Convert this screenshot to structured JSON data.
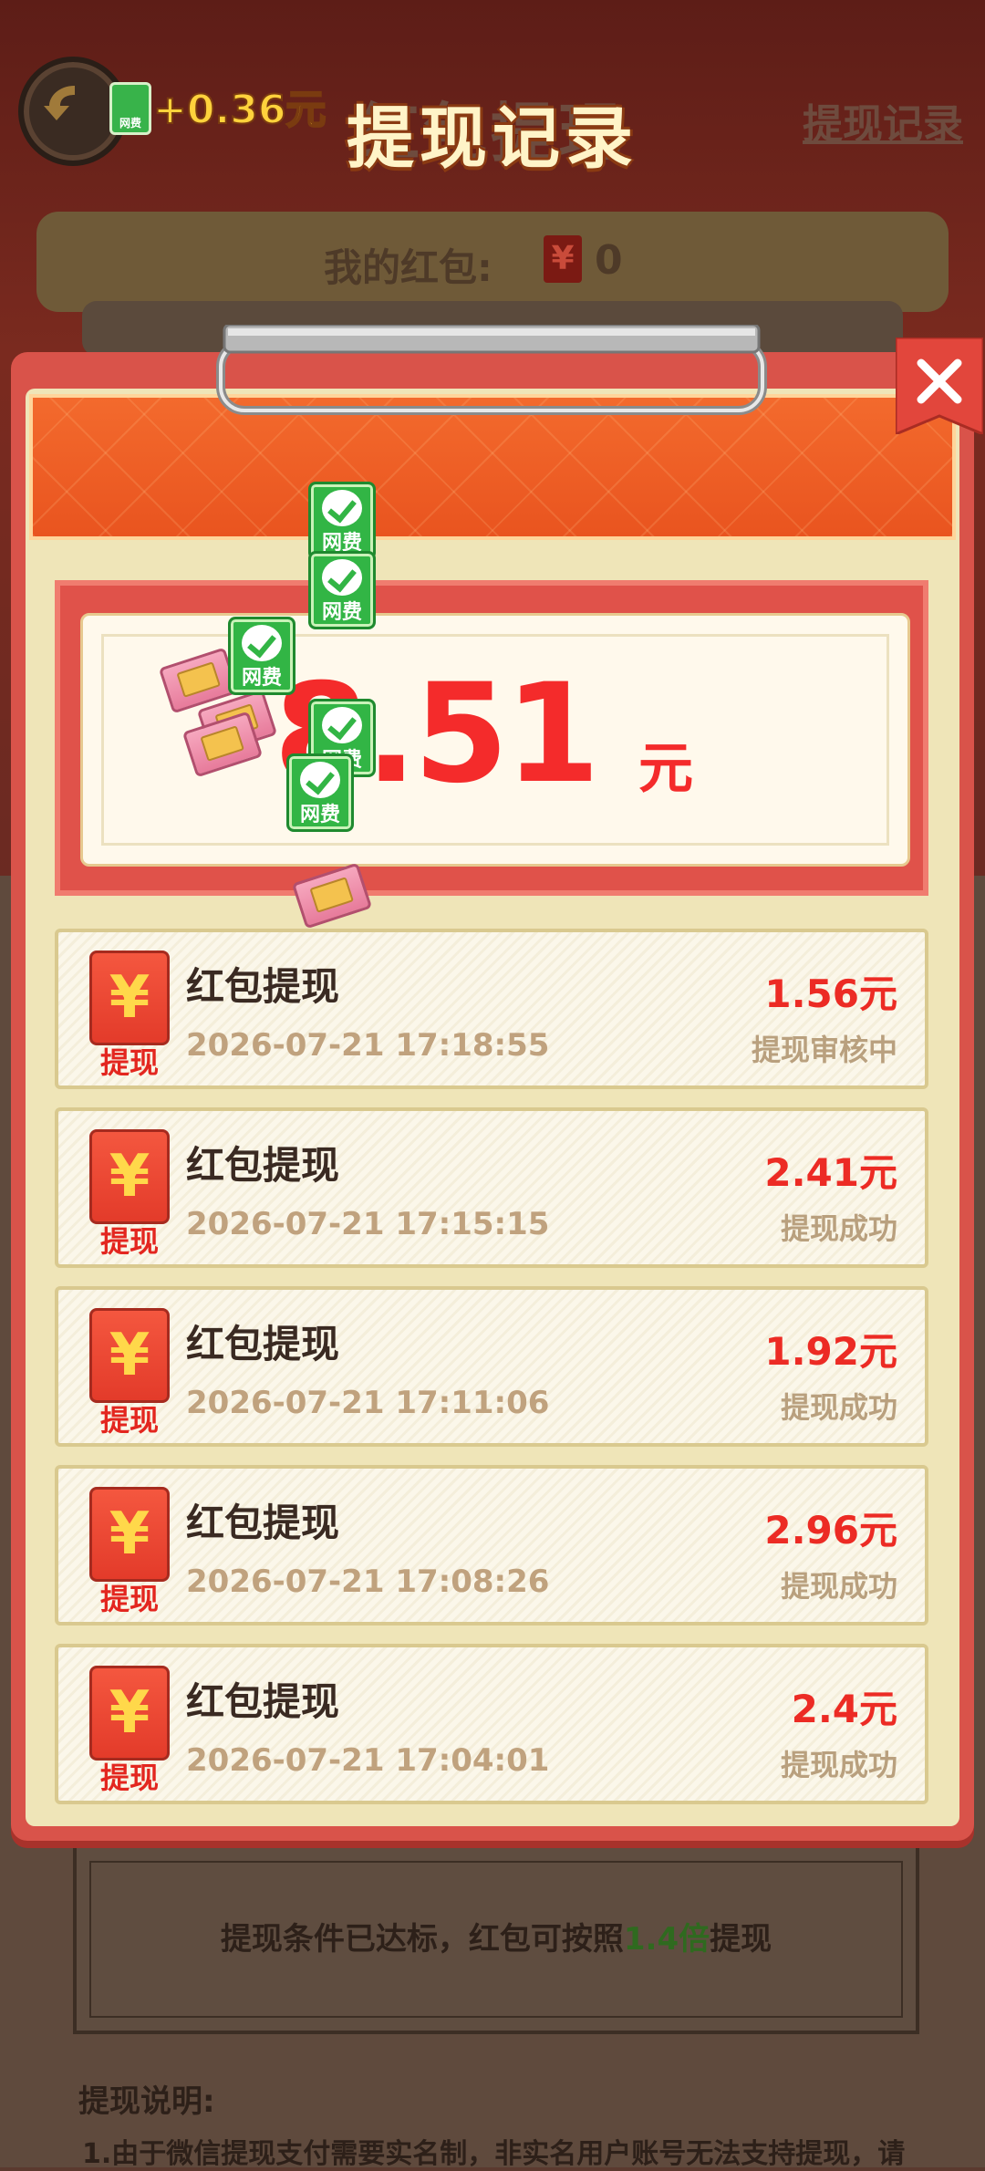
{
  "header": {
    "earn_text": "+0.36元",
    "earn_badge_label": "网费",
    "title": "红包提现",
    "record_link": "提现记录"
  },
  "balance": {
    "label": "我的红包:",
    "yen": "¥",
    "value": "0"
  },
  "condition": {
    "prefix": "提现条件已达标，红包可按照",
    "highlight": "1.4倍",
    "suffix": "提现"
  },
  "explain": {
    "title": "提现说明:",
    "line1": "1.由于微信提现支付需要实名制，非实名用户账号无法支持提现，请"
  },
  "modal": {
    "title": "提现记录",
    "total_value": "8.51",
    "total_unit": "元",
    "fly_badge_label": "网费",
    "records": [
      {
        "icon": "¥",
        "icon_label": "提现",
        "title": "红包提现",
        "time": "2026-07-21 17:18:55",
        "amount": "1.56元",
        "status": "提现审核中"
      },
      {
        "icon": "¥",
        "icon_label": "提现",
        "title": "红包提现",
        "time": "2026-07-21 17:15:15",
        "amount": "2.41元",
        "status": "提现成功"
      },
      {
        "icon": "¥",
        "icon_label": "提现",
        "title": "红包提现",
        "time": "2026-07-21 17:11:06",
        "amount": "1.92元",
        "status": "提现成功"
      },
      {
        "icon": "¥",
        "icon_label": "提现",
        "title": "红包提现",
        "time": "2026-07-21 17:08:26",
        "amount": "2.96元",
        "status": "提现成功"
      },
      {
        "icon": "¥",
        "icon_label": "提现",
        "title": "红包提现",
        "time": "2026-07-21 17:04:01",
        "amount": "2.4元",
        "status": "提现成功"
      }
    ]
  },
  "colors": {
    "accent_red": "#ec2b24",
    "header_orange": "#f36a2d",
    "wechat_green": "#32b545"
  },
  "icons": [
    "back-arrow-icon",
    "close-icon",
    "wechat-pay-icon",
    "yen-icon",
    "money-stack-icon"
  ]
}
